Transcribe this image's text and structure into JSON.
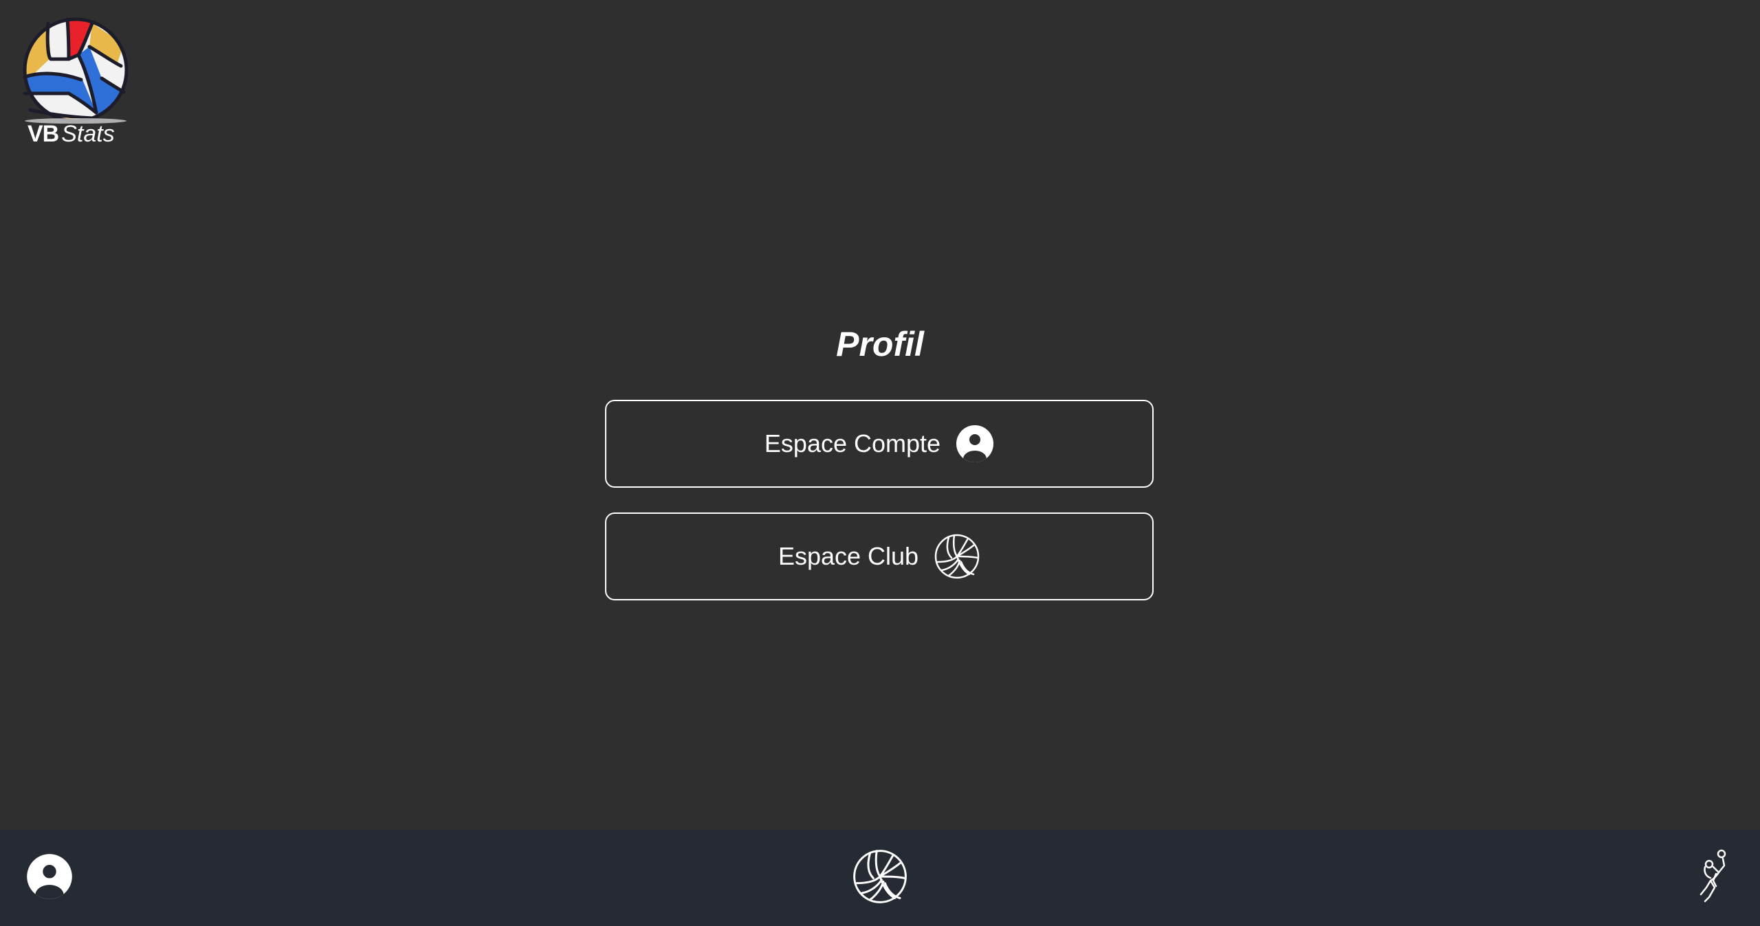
{
  "app": {
    "logo": {
      "brand_bold": "VB",
      "brand_italic": "Stats",
      "colors": {
        "red": "#e8212b",
        "blue": "#2f6fd8",
        "yellow": "#e9b84a",
        "white": "#f2f2f2",
        "outline": "#1c1c2a"
      }
    }
  },
  "main": {
    "title": "Profil",
    "buttons": [
      {
        "label": "Espace Compte",
        "icon": "user-circle-icon"
      },
      {
        "label": "Espace Club",
        "icon": "volleyball-icon"
      }
    ]
  },
  "bottom_nav": {
    "items": [
      {
        "icon": "user-circle-icon"
      },
      {
        "icon": "volleyball-icon"
      },
      {
        "icon": "volleyball-player-icon"
      }
    ]
  },
  "colors": {
    "background": "#2f2f2f",
    "nav_background": "#262a33",
    "foreground": "#ffffff"
  }
}
